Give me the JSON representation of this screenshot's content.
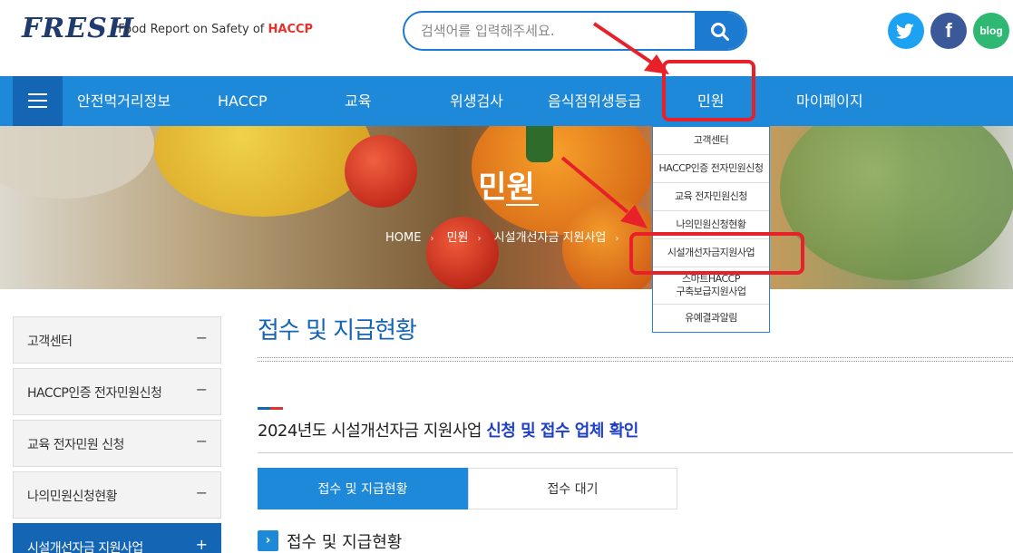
{
  "header": {
    "logo": "FRESH",
    "tagline_prefix": "· Food Report on Safety of ",
    "tagline_highlight": "HACCP",
    "search_placeholder": "검색어를 입력해주세요.",
    "sns": {
      "twitter": "twitter-icon",
      "facebook": "f",
      "blog": "blog"
    }
  },
  "nav": {
    "items": [
      "안전먹거리정보",
      "HACCP",
      "교육",
      "위생검사",
      "음식점위생등급",
      "민원",
      "마이페이지"
    ]
  },
  "hero": {
    "title": "민원",
    "breadcrumb": [
      "HOME",
      "민원",
      "시설개선자금 지원사업"
    ]
  },
  "dropdown": {
    "items": [
      "고객센터",
      "HACCP인증 전자민원신청",
      "교육 전자민원신청",
      "나의민원신청현황",
      "시설개선자금지원사업",
      "스마트HACCP",
      "구축보급지원사업",
      "유예결과알림"
    ]
  },
  "sidebar": {
    "items": [
      {
        "label": "고객센터",
        "sign": "−"
      },
      {
        "label": "HACCP인증 전자민원신청",
        "sign": "−"
      },
      {
        "label": "교육 전자민원 신청",
        "sign": "−"
      },
      {
        "label": "나의민원신청현황",
        "sign": "−"
      },
      {
        "label": "시설개선자금 지원사업",
        "sign": "+"
      }
    ]
  },
  "main": {
    "page_title": "접수 및 지급현황",
    "subtitle_plain": "2024년도 시설개선자금 지원사업 ",
    "subtitle_blue": "신청 및 접수 업체 확인",
    "tabs": [
      "접수 및 지급현황",
      "접수 대기"
    ],
    "section_icon": "›",
    "section_title": "접수 및 지급현황"
  },
  "colors": {
    "primary": "#1e88d9",
    "dark_blue": "#1565b5",
    "annotation_red": "#e8202a"
  }
}
